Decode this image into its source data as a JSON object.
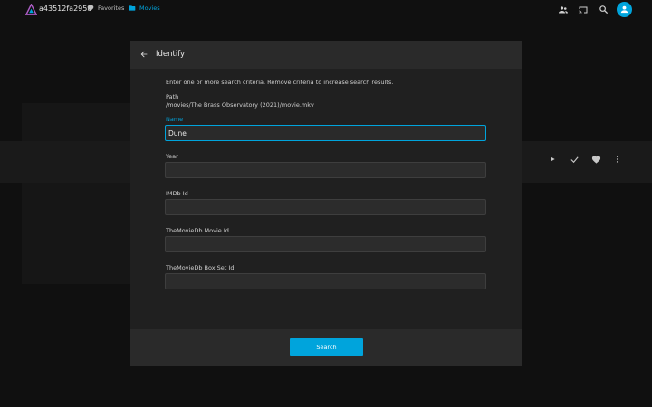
{
  "header": {
    "server_name": "a43512fa2958",
    "nav": {
      "favorites": "Favorites",
      "movies": "Movies"
    },
    "icons": [
      "users-icon",
      "cast-icon",
      "search-icon",
      "user-avatar-icon"
    ],
    "accent_color": "#00a4dc"
  },
  "dialog": {
    "title": "Identify",
    "intro": "Enter one or more search criteria. Remove criteria to increase search results.",
    "path_label": "Path",
    "path_value": "/movies/The Brass Observatory (2021)/movie.mkv",
    "fields": [
      {
        "label": "Name",
        "value": "Dune"
      },
      {
        "label": "Year",
        "value": ""
      },
      {
        "label": "IMDb Id",
        "value": ""
      },
      {
        "label": "TheMovieDb Movie Id",
        "value": ""
      },
      {
        "label": "TheMovieDb Box Set Id",
        "value": ""
      }
    ],
    "search_button": "Search"
  }
}
